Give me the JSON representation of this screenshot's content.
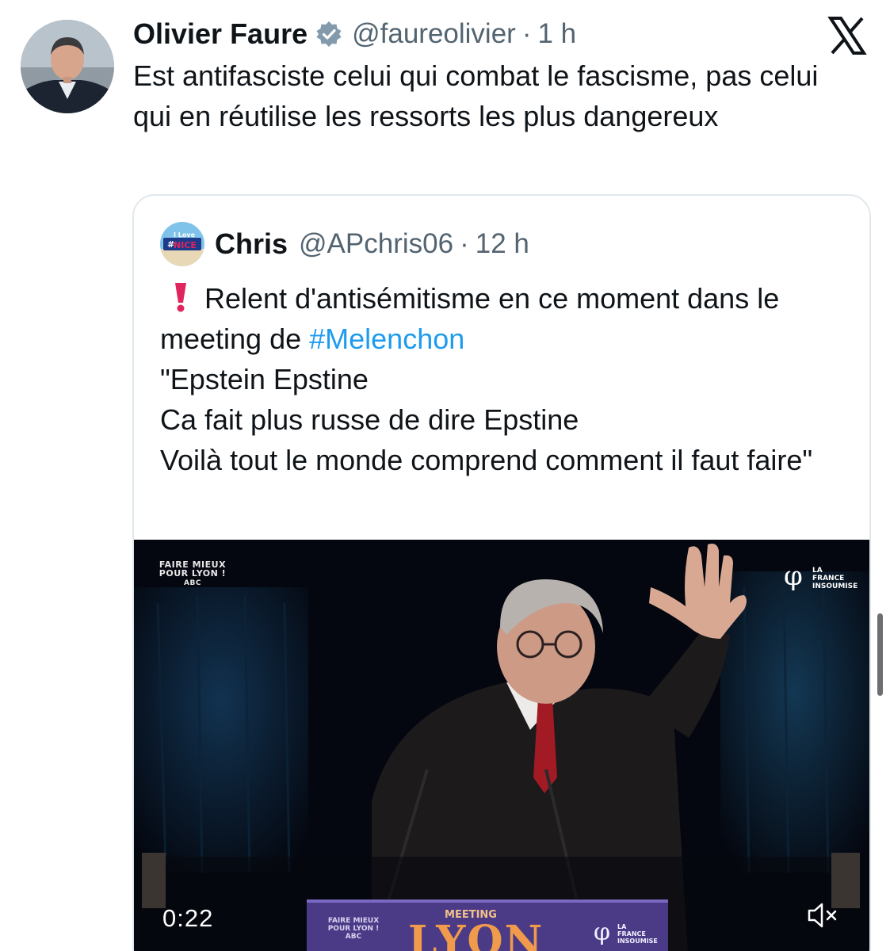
{
  "tweet": {
    "author_name": "Olivier Faure",
    "handle": "@faureolivier",
    "separator": "·",
    "time": "1 h",
    "text": "Est antifasciste celui qui combat le fascisme, pas celui qui en réutilise les ressorts les plus dangereux",
    "verified": true,
    "platform_icon": "x-logo-icon"
  },
  "quote": {
    "author_name": "Chris",
    "handle": "@APchris06",
    "separator": "·",
    "time": "12 h",
    "avatar_text": "I Love #NICE",
    "text_line1": "Relent d'antisémitisme en ce moment dans le meeting de ",
    "hashtag": "#Melenchon",
    "text_rest": "\"Epstein Epstine\nCa fait plus russe de dire Epstine\nVoilà tout le monde comprend comment il faut faire\""
  },
  "video": {
    "timer": "0:22",
    "muted": true,
    "overlay_left": "FAIRE MIEUX POUR LYON !",
    "overlay_left_sub": "ABC",
    "overlay_right_line1": "LA",
    "overlay_right_line2": "FRANCE",
    "overlay_right_line3": "INSOUMISE",
    "lectern_left": "FAIRE MIEUX POUR LYON !",
    "lectern_left_sub": "ABC",
    "lectern_meeting": "MEETING",
    "lectern_city": "LYON",
    "lectern_lfi_line1": "LA",
    "lectern_lfi_line2": "FRANCE",
    "lectern_lfi_line3": "INSOUMISE"
  },
  "colors": {
    "text": "#0f1419",
    "secondary": "#536471",
    "link": "#1d9bf0",
    "verified": "#829aab",
    "border": "#e1e8ed",
    "alert": "#e0245e"
  }
}
